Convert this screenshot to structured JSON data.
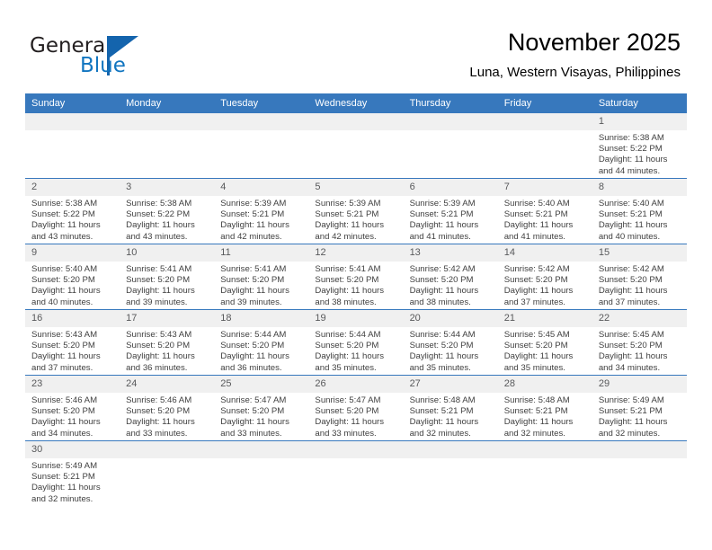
{
  "logo": {
    "word_dark": "General",
    "word_blue": "Blue",
    "triangle_color": "#1464ad",
    "blue_text_color": "#1175c0"
  },
  "header": {
    "title": "November 2025",
    "subtitle": "Luna, Western Visayas, Philippines"
  },
  "theme": {
    "header_bg": "#3778bd",
    "daynum_bg": "#f0f0f0",
    "row_divider": "#3778bd",
    "text": "#404040"
  },
  "calendar": {
    "weekday_headers": [
      "Sunday",
      "Monday",
      "Tuesday",
      "Wednesday",
      "Thursday",
      "Friday",
      "Saturday"
    ],
    "weeks": [
      [
        {
          "day": "",
          "sunrise": "",
          "sunset": "",
          "daylight_line1": "",
          "daylight_line2": ""
        },
        {
          "day": "",
          "sunrise": "",
          "sunset": "",
          "daylight_line1": "",
          "daylight_line2": ""
        },
        {
          "day": "",
          "sunrise": "",
          "sunset": "",
          "daylight_line1": "",
          "daylight_line2": ""
        },
        {
          "day": "",
          "sunrise": "",
          "sunset": "",
          "daylight_line1": "",
          "daylight_line2": ""
        },
        {
          "day": "",
          "sunrise": "",
          "sunset": "",
          "daylight_line1": "",
          "daylight_line2": ""
        },
        {
          "day": "",
          "sunrise": "",
          "sunset": "",
          "daylight_line1": "",
          "daylight_line2": ""
        },
        {
          "day": "1",
          "sunrise": "Sunrise: 5:38 AM",
          "sunset": "Sunset: 5:22 PM",
          "daylight_line1": "Daylight: 11 hours",
          "daylight_line2": "and 44 minutes."
        }
      ],
      [
        {
          "day": "2",
          "sunrise": "Sunrise: 5:38 AM",
          "sunset": "Sunset: 5:22 PM",
          "daylight_line1": "Daylight: 11 hours",
          "daylight_line2": "and 43 minutes."
        },
        {
          "day": "3",
          "sunrise": "Sunrise: 5:38 AM",
          "sunset": "Sunset: 5:22 PM",
          "daylight_line1": "Daylight: 11 hours",
          "daylight_line2": "and 43 minutes."
        },
        {
          "day": "4",
          "sunrise": "Sunrise: 5:39 AM",
          "sunset": "Sunset: 5:21 PM",
          "daylight_line1": "Daylight: 11 hours",
          "daylight_line2": "and 42 minutes."
        },
        {
          "day": "5",
          "sunrise": "Sunrise: 5:39 AM",
          "sunset": "Sunset: 5:21 PM",
          "daylight_line1": "Daylight: 11 hours",
          "daylight_line2": "and 42 minutes."
        },
        {
          "day": "6",
          "sunrise": "Sunrise: 5:39 AM",
          "sunset": "Sunset: 5:21 PM",
          "daylight_line1": "Daylight: 11 hours",
          "daylight_line2": "and 41 minutes."
        },
        {
          "day": "7",
          "sunrise": "Sunrise: 5:40 AM",
          "sunset": "Sunset: 5:21 PM",
          "daylight_line1": "Daylight: 11 hours",
          "daylight_line2": "and 41 minutes."
        },
        {
          "day": "8",
          "sunrise": "Sunrise: 5:40 AM",
          "sunset": "Sunset: 5:21 PM",
          "daylight_line1": "Daylight: 11 hours",
          "daylight_line2": "and 40 minutes."
        }
      ],
      [
        {
          "day": "9",
          "sunrise": "Sunrise: 5:40 AM",
          "sunset": "Sunset: 5:20 PM",
          "daylight_line1": "Daylight: 11 hours",
          "daylight_line2": "and 40 minutes."
        },
        {
          "day": "10",
          "sunrise": "Sunrise: 5:41 AM",
          "sunset": "Sunset: 5:20 PM",
          "daylight_line1": "Daylight: 11 hours",
          "daylight_line2": "and 39 minutes."
        },
        {
          "day": "11",
          "sunrise": "Sunrise: 5:41 AM",
          "sunset": "Sunset: 5:20 PM",
          "daylight_line1": "Daylight: 11 hours",
          "daylight_line2": "and 39 minutes."
        },
        {
          "day": "12",
          "sunrise": "Sunrise: 5:41 AM",
          "sunset": "Sunset: 5:20 PM",
          "daylight_line1": "Daylight: 11 hours",
          "daylight_line2": "and 38 minutes."
        },
        {
          "day": "13",
          "sunrise": "Sunrise: 5:42 AM",
          "sunset": "Sunset: 5:20 PM",
          "daylight_line1": "Daylight: 11 hours",
          "daylight_line2": "and 38 minutes."
        },
        {
          "day": "14",
          "sunrise": "Sunrise: 5:42 AM",
          "sunset": "Sunset: 5:20 PM",
          "daylight_line1": "Daylight: 11 hours",
          "daylight_line2": "and 37 minutes."
        },
        {
          "day": "15",
          "sunrise": "Sunrise: 5:42 AM",
          "sunset": "Sunset: 5:20 PM",
          "daylight_line1": "Daylight: 11 hours",
          "daylight_line2": "and 37 minutes."
        }
      ],
      [
        {
          "day": "16",
          "sunrise": "Sunrise: 5:43 AM",
          "sunset": "Sunset: 5:20 PM",
          "daylight_line1": "Daylight: 11 hours",
          "daylight_line2": "and 37 minutes."
        },
        {
          "day": "17",
          "sunrise": "Sunrise: 5:43 AM",
          "sunset": "Sunset: 5:20 PM",
          "daylight_line1": "Daylight: 11 hours",
          "daylight_line2": "and 36 minutes."
        },
        {
          "day": "18",
          "sunrise": "Sunrise: 5:44 AM",
          "sunset": "Sunset: 5:20 PM",
          "daylight_line1": "Daylight: 11 hours",
          "daylight_line2": "and 36 minutes."
        },
        {
          "day": "19",
          "sunrise": "Sunrise: 5:44 AM",
          "sunset": "Sunset: 5:20 PM",
          "daylight_line1": "Daylight: 11 hours",
          "daylight_line2": "and 35 minutes."
        },
        {
          "day": "20",
          "sunrise": "Sunrise: 5:44 AM",
          "sunset": "Sunset: 5:20 PM",
          "daylight_line1": "Daylight: 11 hours",
          "daylight_line2": "and 35 minutes."
        },
        {
          "day": "21",
          "sunrise": "Sunrise: 5:45 AM",
          "sunset": "Sunset: 5:20 PM",
          "daylight_line1": "Daylight: 11 hours",
          "daylight_line2": "and 35 minutes."
        },
        {
          "day": "22",
          "sunrise": "Sunrise: 5:45 AM",
          "sunset": "Sunset: 5:20 PM",
          "daylight_line1": "Daylight: 11 hours",
          "daylight_line2": "and 34 minutes."
        }
      ],
      [
        {
          "day": "23",
          "sunrise": "Sunrise: 5:46 AM",
          "sunset": "Sunset: 5:20 PM",
          "daylight_line1": "Daylight: 11 hours",
          "daylight_line2": "and 34 minutes."
        },
        {
          "day": "24",
          "sunrise": "Sunrise: 5:46 AM",
          "sunset": "Sunset: 5:20 PM",
          "daylight_line1": "Daylight: 11 hours",
          "daylight_line2": "and 33 minutes."
        },
        {
          "day": "25",
          "sunrise": "Sunrise: 5:47 AM",
          "sunset": "Sunset: 5:20 PM",
          "daylight_line1": "Daylight: 11 hours",
          "daylight_line2": "and 33 minutes."
        },
        {
          "day": "26",
          "sunrise": "Sunrise: 5:47 AM",
          "sunset": "Sunset: 5:20 PM",
          "daylight_line1": "Daylight: 11 hours",
          "daylight_line2": "and 33 minutes."
        },
        {
          "day": "27",
          "sunrise": "Sunrise: 5:48 AM",
          "sunset": "Sunset: 5:21 PM",
          "daylight_line1": "Daylight: 11 hours",
          "daylight_line2": "and 32 minutes."
        },
        {
          "day": "28",
          "sunrise": "Sunrise: 5:48 AM",
          "sunset": "Sunset: 5:21 PM",
          "daylight_line1": "Daylight: 11 hours",
          "daylight_line2": "and 32 minutes."
        },
        {
          "day": "29",
          "sunrise": "Sunrise: 5:49 AM",
          "sunset": "Sunset: 5:21 PM",
          "daylight_line1": "Daylight: 11 hours",
          "daylight_line2": "and 32 minutes."
        }
      ],
      [
        {
          "day": "30",
          "sunrise": "Sunrise: 5:49 AM",
          "sunset": "Sunset: 5:21 PM",
          "daylight_line1": "Daylight: 11 hours",
          "daylight_line2": "and 32 minutes."
        },
        {
          "day": "",
          "sunrise": "",
          "sunset": "",
          "daylight_line1": "",
          "daylight_line2": ""
        },
        {
          "day": "",
          "sunrise": "",
          "sunset": "",
          "daylight_line1": "",
          "daylight_line2": ""
        },
        {
          "day": "",
          "sunrise": "",
          "sunset": "",
          "daylight_line1": "",
          "daylight_line2": ""
        },
        {
          "day": "",
          "sunrise": "",
          "sunset": "",
          "daylight_line1": "",
          "daylight_line2": ""
        },
        {
          "day": "",
          "sunrise": "",
          "sunset": "",
          "daylight_line1": "",
          "daylight_line2": ""
        },
        {
          "day": "",
          "sunrise": "",
          "sunset": "",
          "daylight_line1": "",
          "daylight_line2": ""
        }
      ]
    ]
  }
}
